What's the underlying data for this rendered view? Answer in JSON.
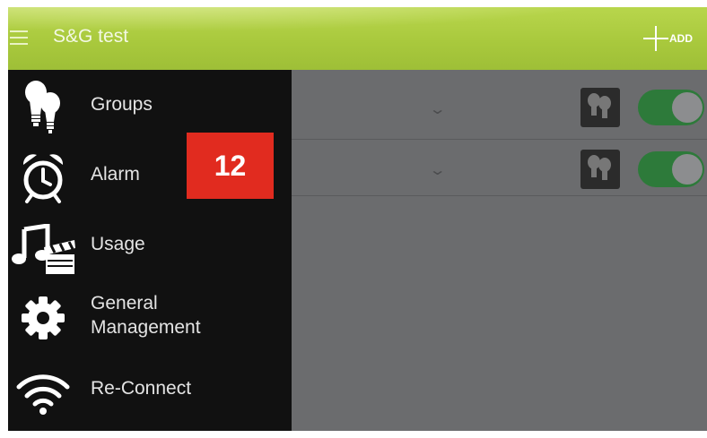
{
  "app": {
    "title": "S&G test",
    "add_label": "ADD"
  },
  "drawer": {
    "items": [
      {
        "label": "Groups",
        "icon": "lightbulb-icon"
      },
      {
        "label": "Alarm",
        "icon": "alarm-clock-icon"
      },
      {
        "label": "Usage",
        "icon": "music-clapper-icon"
      },
      {
        "label": "General\nManagement",
        "icon": "gear-icon"
      },
      {
        "label": "Re-Connect",
        "icon": "wifi-icon"
      }
    ]
  },
  "callout": {
    "number": "12"
  },
  "group_rows": [
    {
      "toggle_on": true
    },
    {
      "toggle_on": true
    }
  ],
  "colors": {
    "header_green": "#a9c93d",
    "drawer_bg": "#111111",
    "toggle_on": "#2d7a3a",
    "callout_red": "#e12b1f"
  }
}
